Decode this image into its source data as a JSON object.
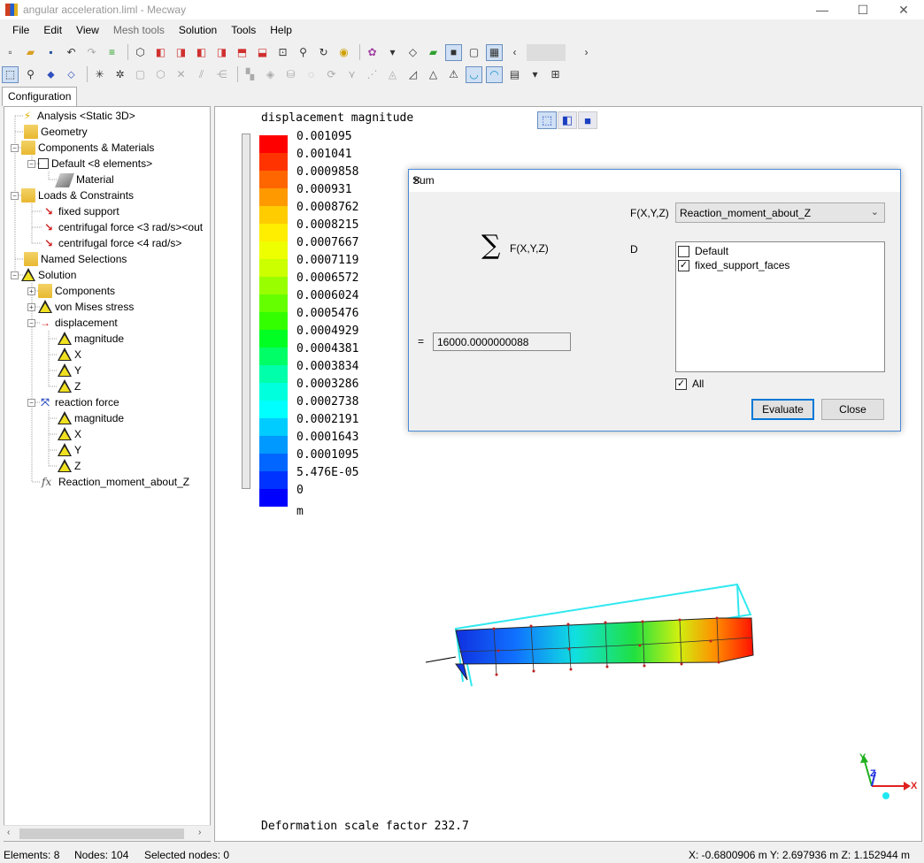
{
  "window": {
    "title": "angular acceleration.liml - Mecway",
    "minimize": "—",
    "maximize": "☐",
    "close": "✕"
  },
  "menu": [
    "File",
    "Edit",
    "View",
    "Mesh tools",
    "Solution",
    "Tools",
    "Help"
  ],
  "tab": "Configuration",
  "tree": {
    "analysis": "Analysis <Static 3D>",
    "geometry": "Geometry",
    "components_materials": "Components & Materials",
    "default": "Default <8 elements>",
    "material": "Material",
    "loads_constraints": "Loads & Constraints",
    "fixed_support": "fixed support",
    "centrifugal_3": "centrifugal force <3 rad/s><out",
    "centrifugal_4": "centrifugal force <4 rad/s>",
    "named_selections": "Named Selections",
    "solution": "Solution",
    "components": "Components",
    "von_mises": "von Mises stress",
    "displacement": "displacement",
    "disp_magnitude": "magnitude",
    "disp_x": "X",
    "disp_y": "Y",
    "disp_z": "Z",
    "reaction_force": "reaction force",
    "rf_magnitude": "magnitude",
    "rf_x": "X",
    "rf_y": "Y",
    "rf_z": "Z",
    "reaction_moment": "Reaction_moment_about_Z",
    "fx_symbol": "fx"
  },
  "view": {
    "legend_title": "displacement magnitude",
    "legend_values": [
      "0.001095",
      "0.001041",
      "0.0009858",
      "0.000931",
      "0.0008762",
      "0.0008215",
      "0.0007667",
      "0.0007119",
      "0.0006572",
      "0.0006024",
      "0.0005476",
      "0.0004929",
      "0.0004381",
      "0.0003834",
      "0.0003286",
      "0.0002738",
      "0.0002191",
      "0.0001643",
      "0.0001095",
      "5.476E-05",
      "0"
    ],
    "legend_colors": [
      "#ff0000",
      "#ff3300",
      "#ff6600",
      "#ff9900",
      "#ffcc00",
      "#ffee00",
      "#eeff00",
      "#ccff00",
      "#99ff00",
      "#66ff00",
      "#33ff00",
      "#00ff22",
      "#00ff66",
      "#00ffaa",
      "#00ffdd",
      "#00ffff",
      "#00ccff",
      "#0099ff",
      "#0066ff",
      "#0033ff",
      "#0000ff"
    ],
    "unit": "m",
    "scale_factor": "Deformation scale factor 232.7",
    "axis_x": "X",
    "axis_y": "Y",
    "axis_z": "Z"
  },
  "dialog": {
    "title": "Sum",
    "sum_symbol": "∑",
    "sum_fx": "F(X,Y,Z)",
    "fxyz_label": "F(X,Y,Z)",
    "fxyz_value": "Reaction_moment_about_Z",
    "d_label": "D",
    "eq_label": "=",
    "result": "16000.0000000088",
    "list": [
      {
        "label": "Default",
        "checked": false
      },
      {
        "label": "fixed_support_faces",
        "checked": true
      }
    ],
    "all_label": "All",
    "all_checked": true,
    "evaluate": "Evaluate",
    "close": "Close"
  },
  "status": {
    "elements": "Elements: 8",
    "nodes": "Nodes: 104",
    "selected": "Selected nodes: 0",
    "coords": "X: -0.6800906 m Y: 2.697936 m Z: 1.152944 m"
  }
}
